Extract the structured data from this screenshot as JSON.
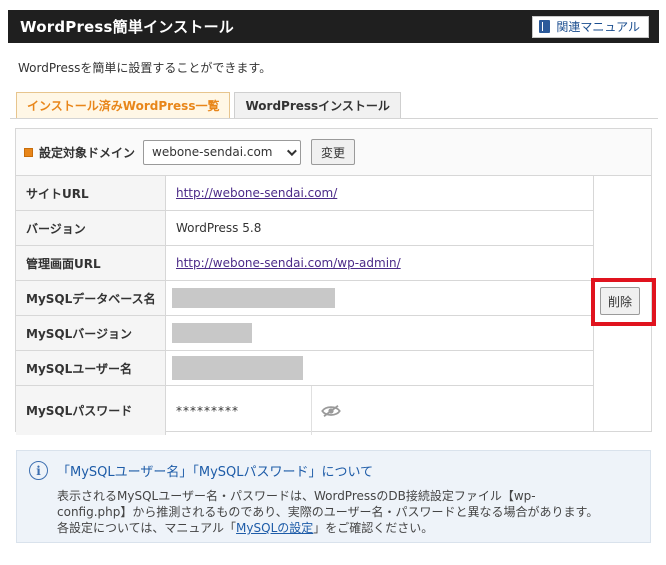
{
  "header": {
    "title": "WordPress簡単インストール",
    "manual_label": "関連マニュアル"
  },
  "intro": "WordPressを簡単に設置することができます。",
  "tabs": [
    {
      "label": "インストール済みWordPress一覧",
      "active": true
    },
    {
      "label": "WordPressインストール",
      "active": false
    }
  ],
  "domain": {
    "label": "設定対象ドメイン",
    "selected": "webone-sendai.com",
    "change_label": "変更"
  },
  "rows": {
    "site_url": {
      "key": "サイトURL",
      "value": "http://webone-sendai.com/"
    },
    "version": {
      "key": "バージョン",
      "value": "WordPress 5.8"
    },
    "admin_url": {
      "key": "管理画面URL",
      "value": "http://webone-sendai.com/wp-admin/"
    },
    "db_name": {
      "key": "MySQLデータベース名"
    },
    "db_version": {
      "key": "MySQLバージョン"
    },
    "db_user": {
      "key": "MySQLユーザー名"
    },
    "db_password": {
      "key": "MySQLパスワード",
      "value": "*********"
    }
  },
  "delete_label": "削除",
  "notice": {
    "title": "「MySQLユーザー名」「MySQLパスワード」について",
    "line1": "表示されるMySQLユーザー名・パスワードは、WordPressのDB接続設定ファイル【wp-",
    "line2": "config.php】から推測されるものであり、実際のユーザー名・パスワードと異なる場合があります。",
    "line3_prefix": "各設定については、マニュアル「",
    "line3_link": "MySQLの設定",
    "line3_suffix": "」をご確認ください。"
  },
  "colors": {
    "header_bg": "#1f1f1f",
    "tab_active_text": "#e8861a",
    "highlight_border": "#e0131e",
    "link": "#4b2a88",
    "notice_title": "#1e5ca8"
  }
}
